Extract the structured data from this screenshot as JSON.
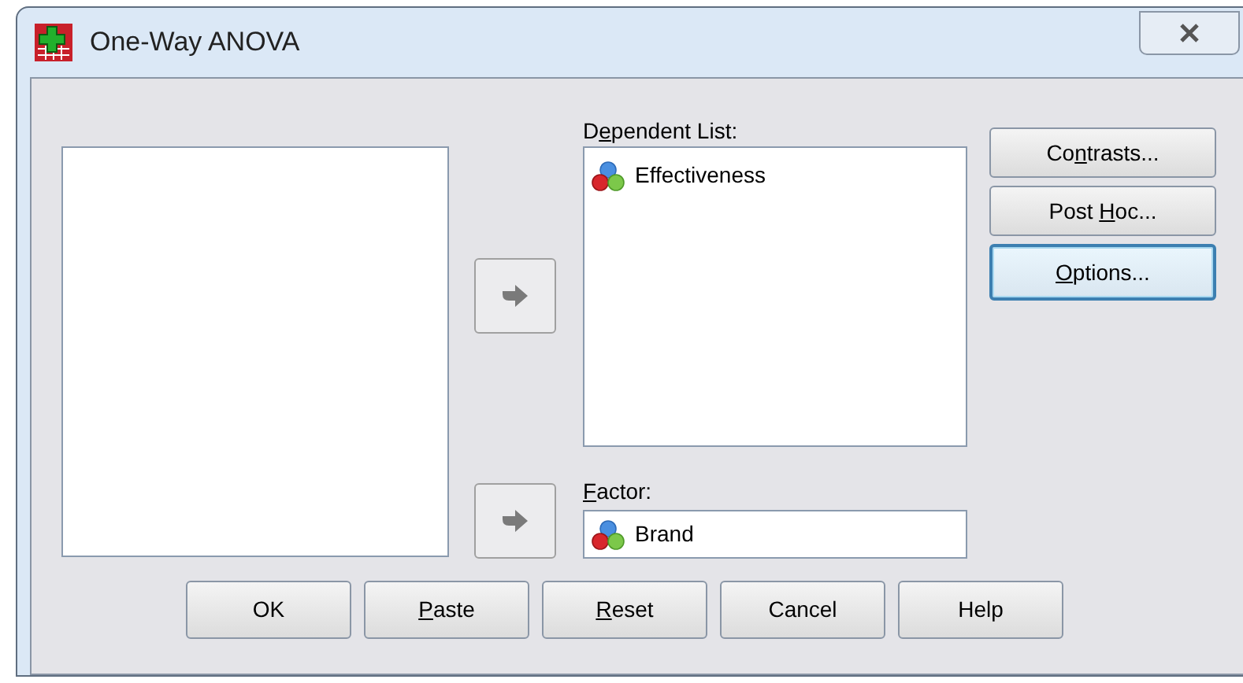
{
  "window": {
    "title": "One-Way ANOVA"
  },
  "dependent_list": {
    "label": {
      "pre": "D",
      "key": "e",
      "post": "pendent List:"
    },
    "items": [
      {
        "name": "Effectiveness"
      }
    ]
  },
  "factor": {
    "label": {
      "key": "F",
      "post": "actor:"
    },
    "value": "Brand"
  },
  "side_buttons": [
    {
      "pre": "Co",
      "key": "n",
      "post": "trasts...",
      "focused": false
    },
    {
      "pre": "Post ",
      "key": "H",
      "post": "oc...",
      "focused": false
    },
    {
      "key": "O",
      "post": "ptions...",
      "focused": true
    }
  ],
  "buttons": [
    {
      "pre": "OK"
    },
    {
      "key": "P",
      "post": "aste"
    },
    {
      "key": "R",
      "post": "eset"
    },
    {
      "pre": "Cancel"
    },
    {
      "pre": "Help"
    }
  ]
}
